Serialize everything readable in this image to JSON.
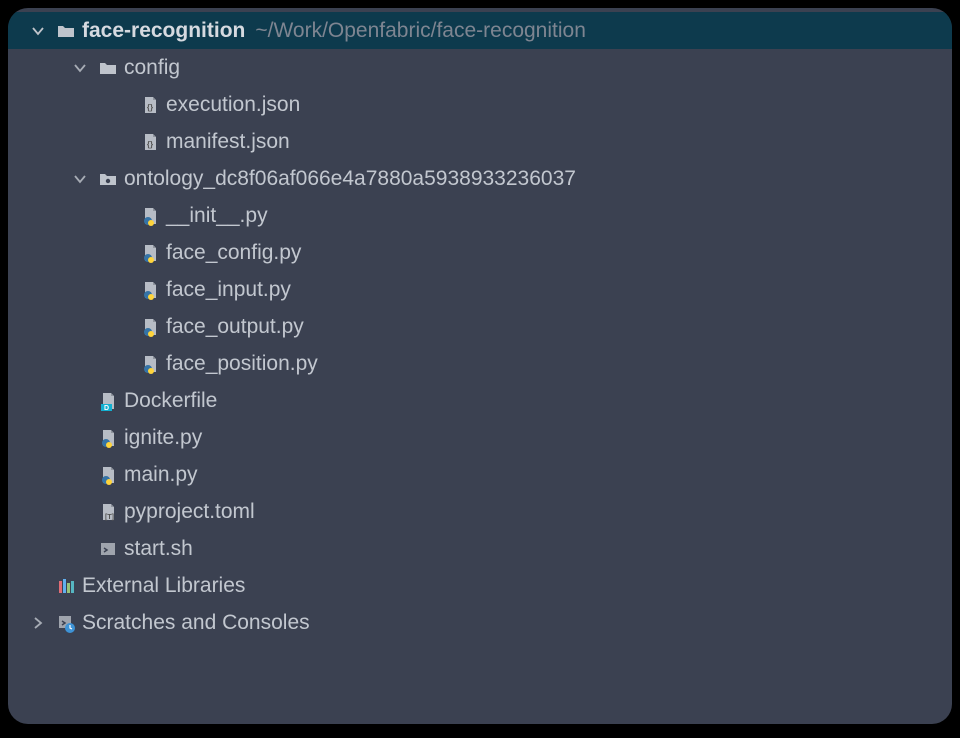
{
  "root": {
    "name": "face-recognition",
    "path": "~/Work/Openfabric/face-recognition"
  },
  "config_folder": "config",
  "config_files": [
    "execution.json",
    "manifest.json"
  ],
  "ontology_folder": "ontology_dc8f06af066e4a7880a5938933236037",
  "ontology_files": [
    "__init__.py",
    "face_config.py",
    "face_input.py",
    "face_output.py",
    "face_position.py"
  ],
  "root_files": {
    "dockerfile": "Dockerfile",
    "ignite": "ignite.py",
    "main": "main.py",
    "pyproject": "pyproject.toml",
    "start": "start.sh"
  },
  "external_libs": "External Libraries",
  "scratches": "Scratches and Consoles"
}
